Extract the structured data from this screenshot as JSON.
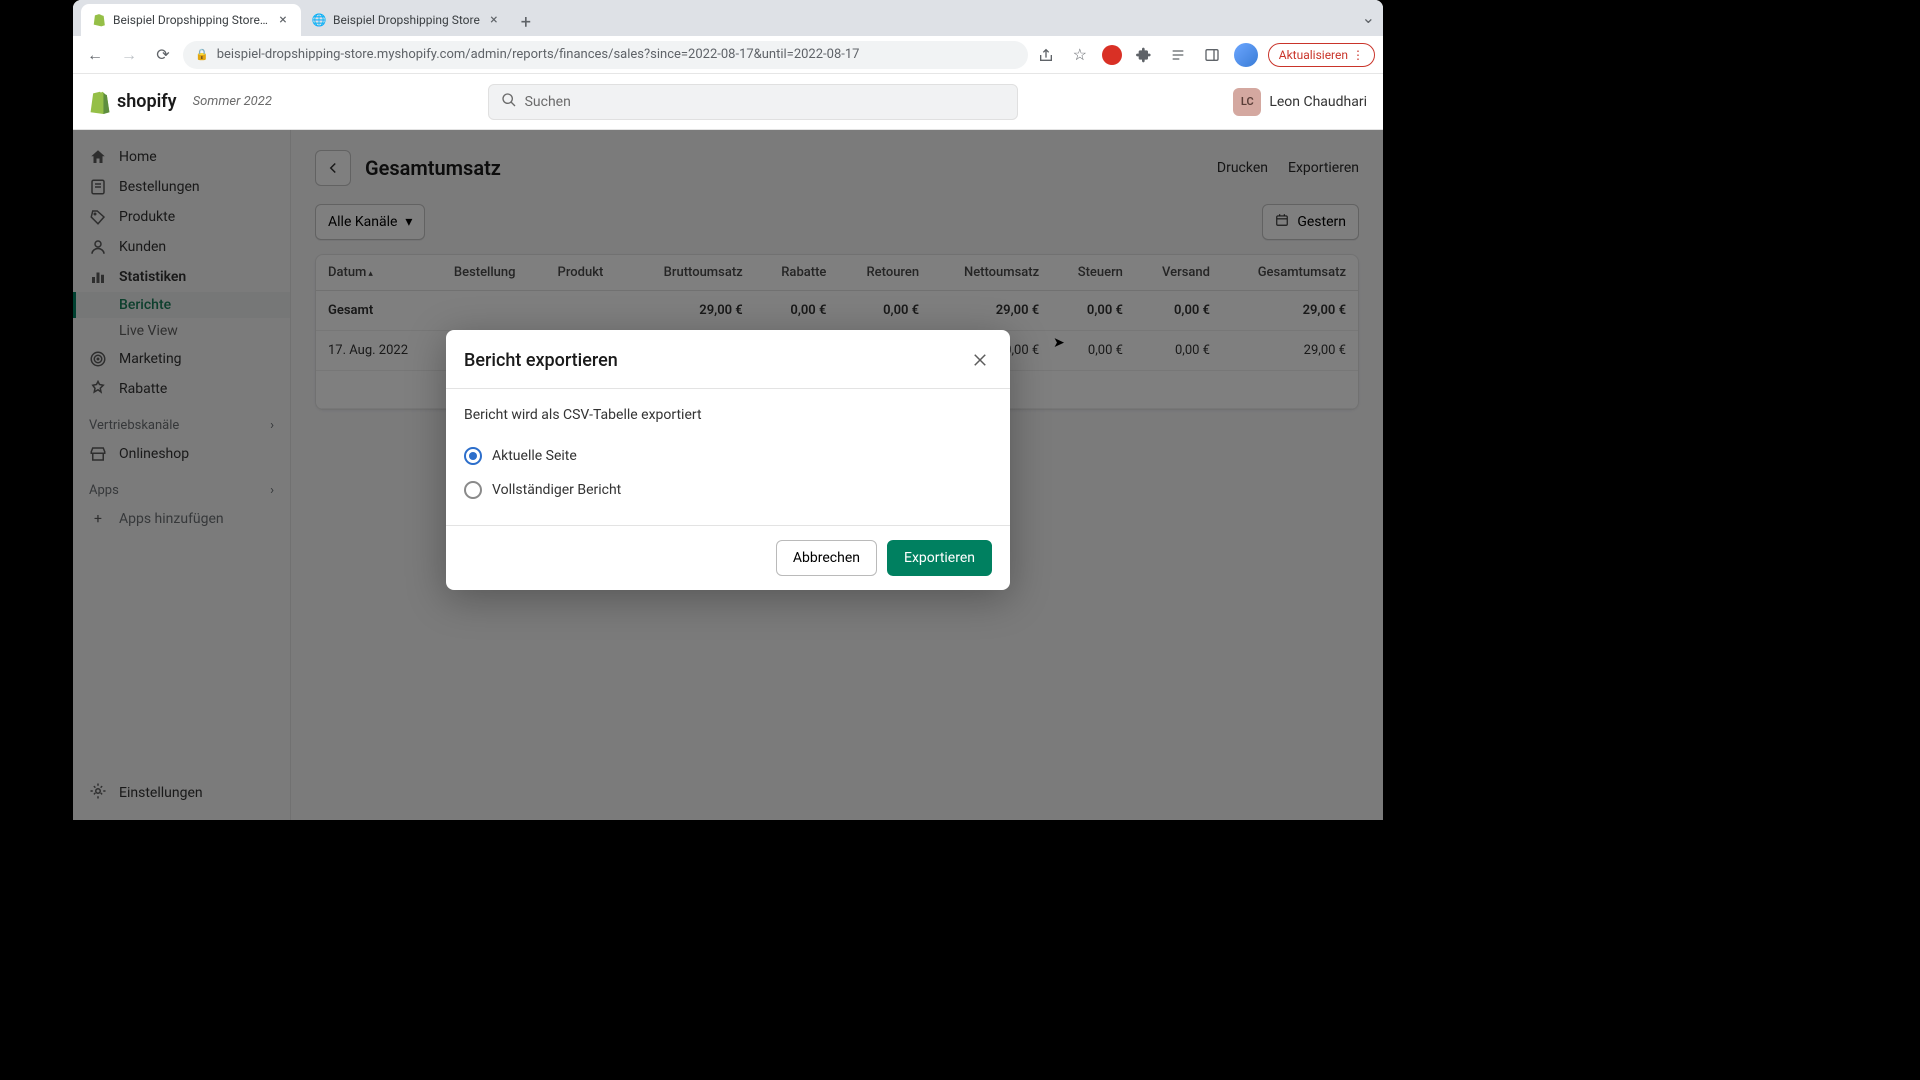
{
  "browser": {
    "tabs": [
      {
        "title": "Beispiel Dropshipping Store · F",
        "active": true,
        "favicon": "shopify"
      },
      {
        "title": "Beispiel Dropshipping Store",
        "active": false,
        "favicon": "globe"
      }
    ],
    "url": "beispiel-dropshipping-store.myshopify.com/admin/reports/finances/sales?since=2022-08-17&until=2022-08-17",
    "update_button": "Aktualisieren"
  },
  "header": {
    "logo_text": "shopify",
    "season": "Sommer 2022",
    "search_placeholder": "Suchen",
    "user_initials": "LC",
    "user_name": "Leon Chaudhari"
  },
  "sidebar": {
    "items": [
      {
        "icon": "home",
        "label": "Home"
      },
      {
        "icon": "orders",
        "label": "Bestellungen"
      },
      {
        "icon": "products",
        "label": "Produkte"
      },
      {
        "icon": "customers",
        "label": "Kunden"
      },
      {
        "icon": "analytics",
        "label": "Statistiken",
        "active_parent": true
      },
      {
        "icon": "marketing",
        "label": "Marketing"
      },
      {
        "icon": "discounts",
        "label": "Rabatte"
      }
    ],
    "sub_items": [
      {
        "label": "Berichte",
        "active": true
      },
      {
        "label": "Live View",
        "active": false
      }
    ],
    "channels_title": "Vertriebskanäle",
    "channels": [
      {
        "icon": "store",
        "label": "Onlineshop"
      }
    ],
    "apps_title": "Apps",
    "apps_add": "Apps hinzufügen",
    "settings": "Einstellungen"
  },
  "page": {
    "title": "Gesamtumsatz",
    "actions": {
      "print": "Drucken",
      "export": "Exportieren"
    },
    "filter_channels": "Alle Kanäle",
    "date_range": "Gestern"
  },
  "table": {
    "columns": [
      "Datum",
      "Bestellung",
      "Produkt",
      "Bruttoumsatz",
      "Rabatte",
      "Retouren",
      "Nettoumsatz",
      "Steuern",
      "Versand",
      "Gesamtumsatz"
    ],
    "total_label": "Gesamt",
    "total_row": [
      "",
      "",
      "29,00 €",
      "0,00 €",
      "0,00 €",
      "29,00 €",
      "0,00 €",
      "0,00 €",
      "29,00 €"
    ],
    "rows": [
      {
        "date": "17. Aug. 2022",
        "order": "#",
        "values": [
          "",
          "",
          "",
          "",
          "0,00 €",
          "0,00 €",
          "0,00 €",
          "29,00 €"
        ]
      }
    ]
  },
  "modal": {
    "title": "Bericht exportieren",
    "description": "Bericht wird als CSV-Tabelle exportiert",
    "options": [
      {
        "label": "Aktuelle Seite",
        "selected": true
      },
      {
        "label": "Vollständiger Bericht",
        "selected": false
      }
    ],
    "cancel": "Abbrechen",
    "confirm": "Exportieren"
  }
}
